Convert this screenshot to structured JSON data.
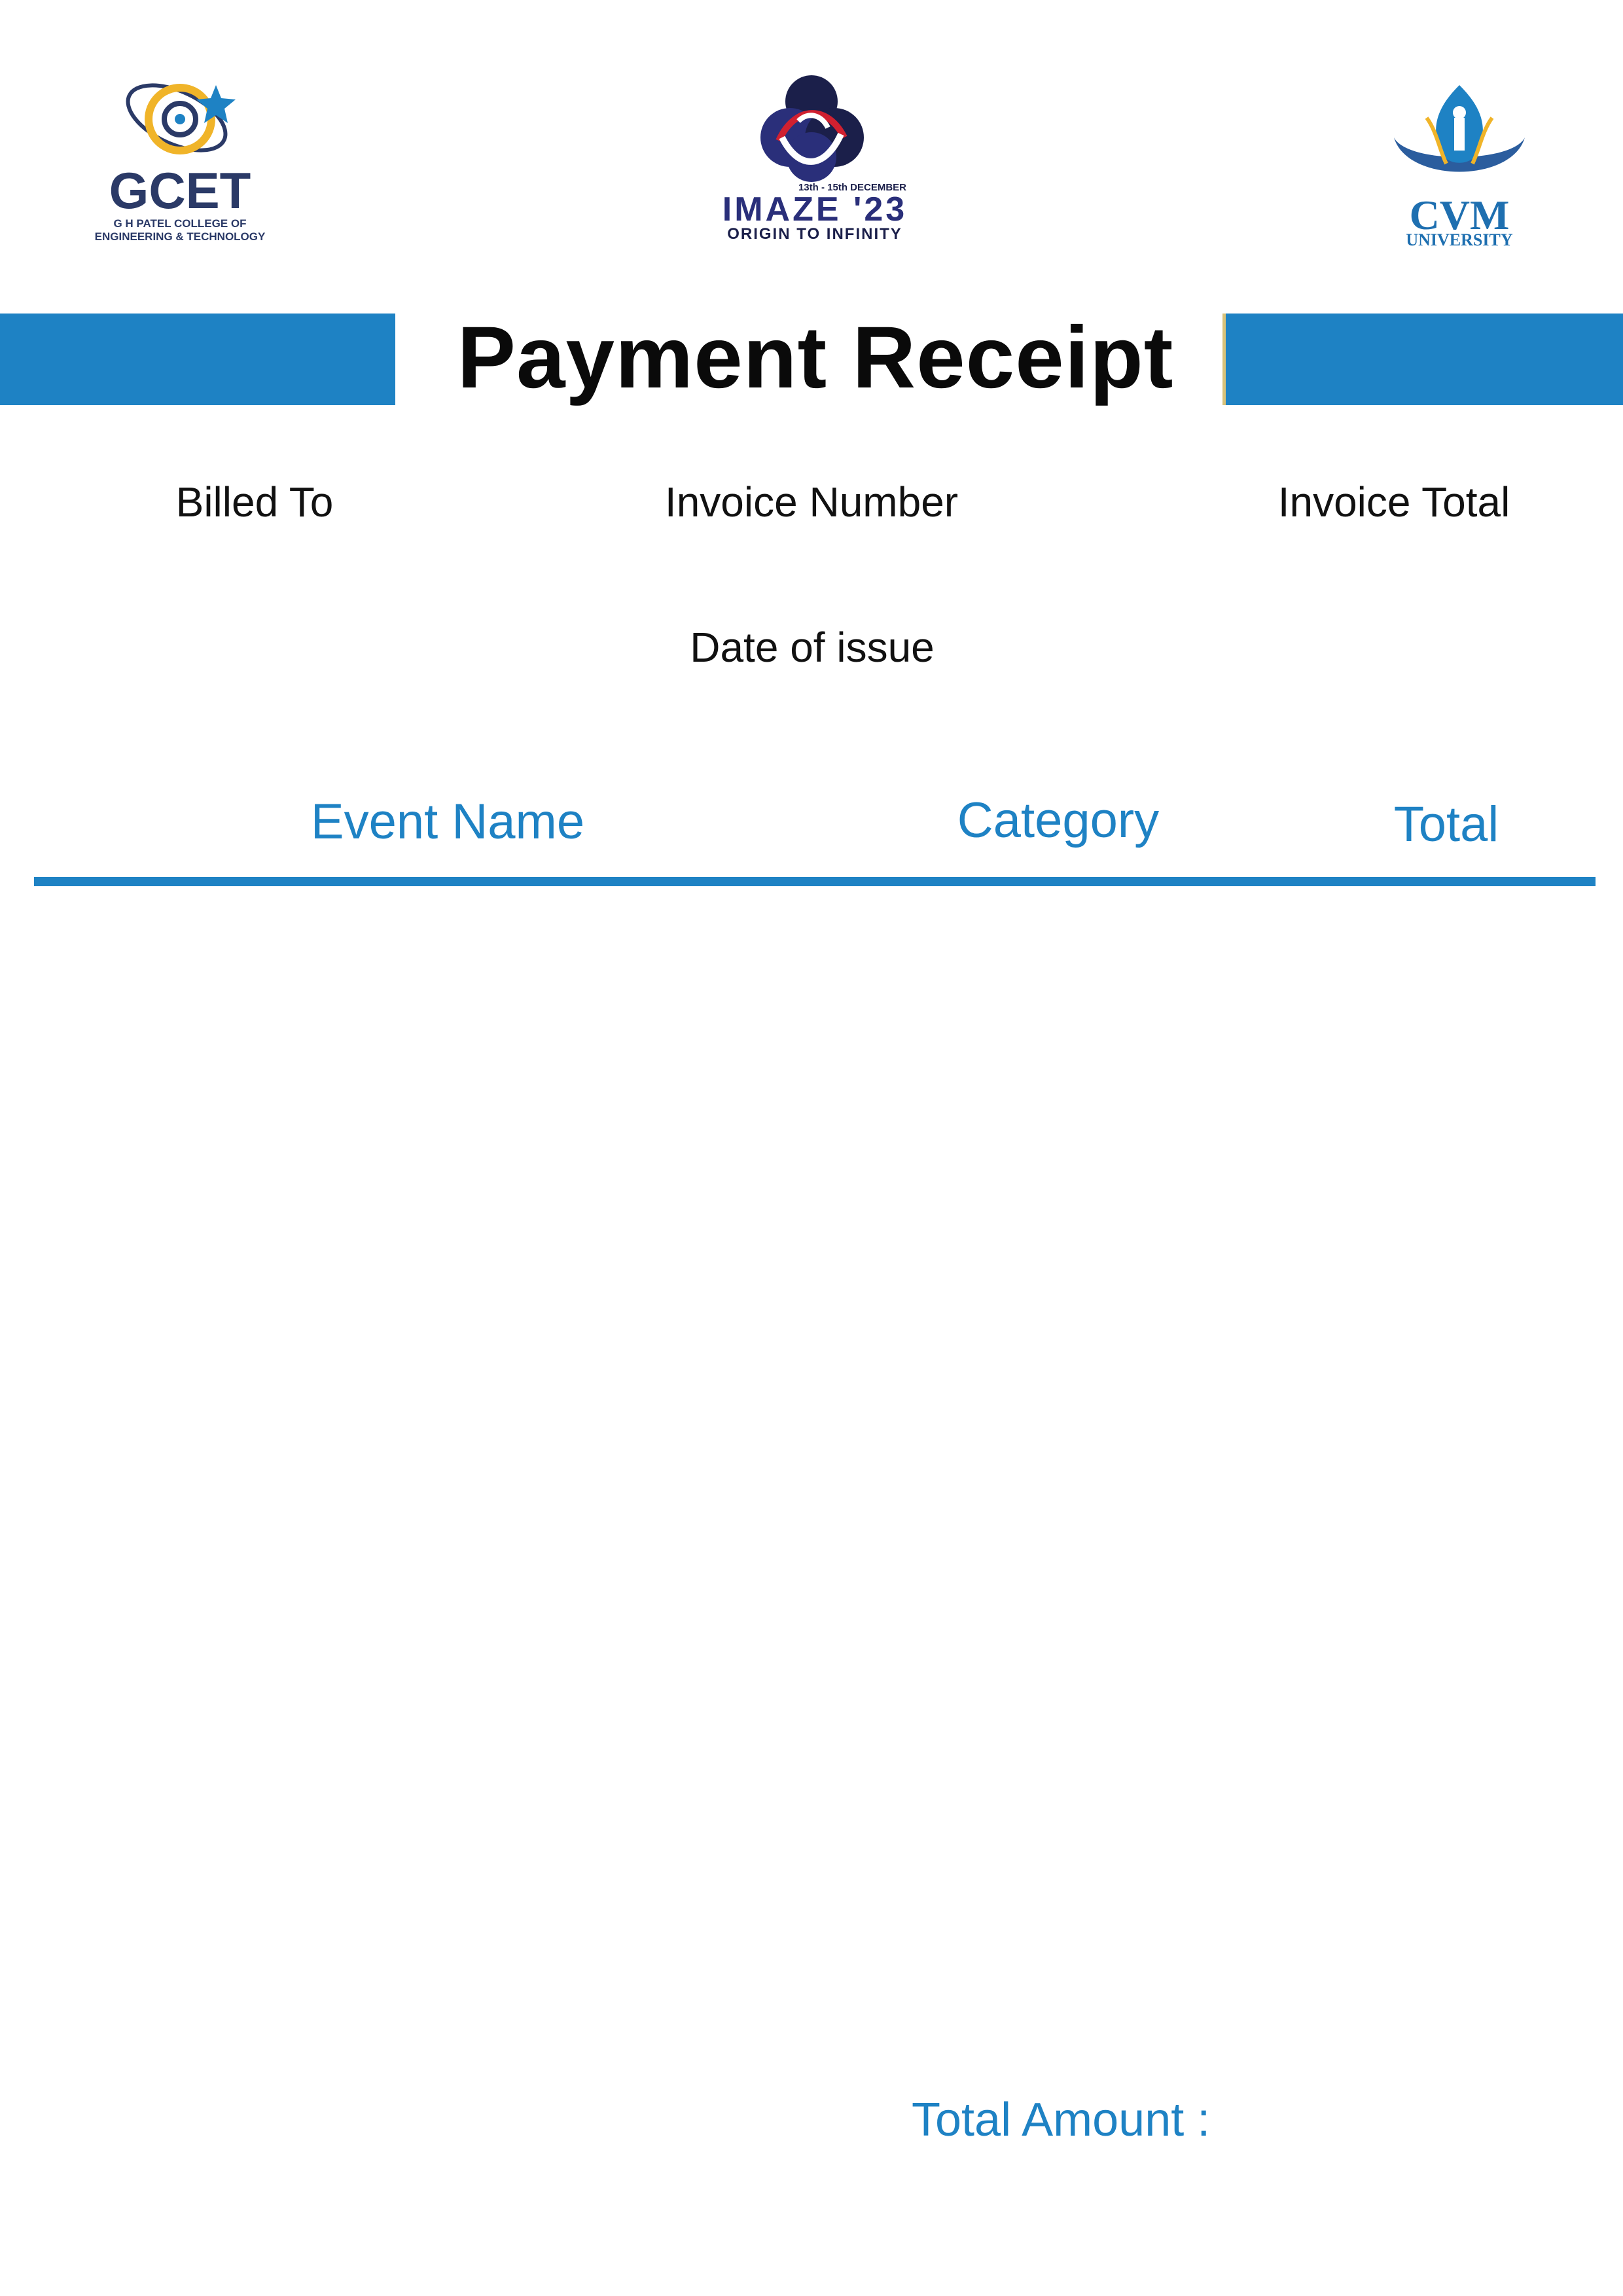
{
  "logos": {
    "left": {
      "name": "GCET",
      "line1": "G H PATEL COLLEGE OF",
      "line2": "ENGINEERING & TECHNOLOGY"
    },
    "center": {
      "dates": "13th - 15th DECEMBER",
      "name": "IMAZE '23",
      "tagline": "ORIGIN TO INFINITY"
    },
    "right": {
      "name": "CVM",
      "subtitle": "UNIVERSITY"
    }
  },
  "title": "Payment Receipt",
  "meta": {
    "billed_to_label": "Billed To",
    "invoice_number_label": "Invoice Number",
    "invoice_total_label": "Invoice Total",
    "date_label": "Date of issue"
  },
  "table": {
    "headers": [
      "Event Name",
      "Category",
      "Total"
    ],
    "rows": []
  },
  "total_amount_label": "Total Amount :",
  "colors": {
    "accent": "#1e82c4",
    "navy": "#2b3a67",
    "gold": "#f0b429",
    "text": "#111111"
  }
}
